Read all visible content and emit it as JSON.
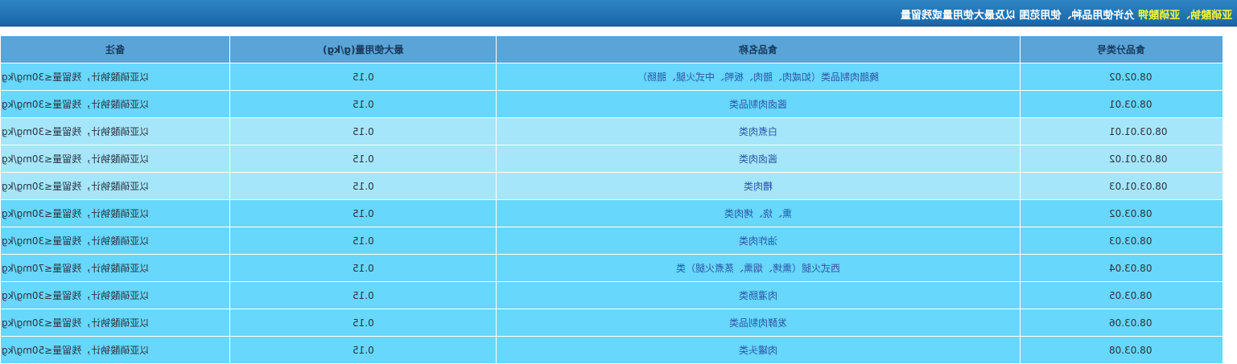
{
  "header": {
    "title_highlight": "亚硝酸钠、亚硝酸钾",
    "title_rest": "  允许使用品种、使用范围 以及最大使用量或残留量"
  },
  "table": {
    "columns": [
      "备注",
      "最大使用量(g/kg)",
      "食品名称",
      "食品分类号"
    ],
    "rows": [
      {
        "note": "以亚硝酸钠计，残留量≤30mg/kg",
        "max": "0.15",
        "name": "腌腊肉制品类（如咸肉、腊肉、板鸭、中式火腿、腊肠）",
        "code": "08.02.02"
      },
      {
        "note": "以亚硝酸钠计，残留量≤30mg/kg",
        "max": "0.15",
        "name": "酱卤肉制品类",
        "code": "08.03.01"
      },
      {
        "note": "以亚硝酸钠计，残留量≤30mg/kg",
        "max": "0.15",
        "name": "白煮肉类",
        "code": "08.03.01.01"
      },
      {
        "note": "以亚硝酸钠计，残留量≤30mg/kg",
        "max": "0.15",
        "name": "酱卤肉类",
        "code": "08.03.01.02"
      },
      {
        "note": "以亚硝酸钠计，残留量≤30mg/kg",
        "max": "0.15",
        "name": "糟肉类",
        "code": "08.03.01.03"
      },
      {
        "note": "以亚硝酸钠计，残留量≤30mg/kg",
        "max": "0.15",
        "name": "熏、烧、烤肉类",
        "code": "08.03.02"
      },
      {
        "note": "以亚硝酸钠计，残留量≤30mg/kg",
        "max": "0.15",
        "name": "油炸肉类",
        "code": "08.03.03"
      },
      {
        "note": "以亚硝酸钠计，残留量≤70mg/kg",
        "max": "0.15",
        "name": "西式火腿（熏烤、烟熏、蒸煮火腿）类",
        "code": "08.03.04"
      },
      {
        "note": "以亚硝酸钠计，残留量≤30mg/kg",
        "max": "0.15",
        "name": "肉灌肠类",
        "code": "08.03.05"
      },
      {
        "note": "以亚硝酸钠计，残留量≤30mg/kg",
        "max": "0.15",
        "name": "发酵肉制品类",
        "code": "08.03.06"
      },
      {
        "note": "以亚硝酸钠计，残留量≤50mg/kg",
        "max": "0.15",
        "name": "肉罐头类",
        "code": "08.03.08"
      }
    ]
  }
}
